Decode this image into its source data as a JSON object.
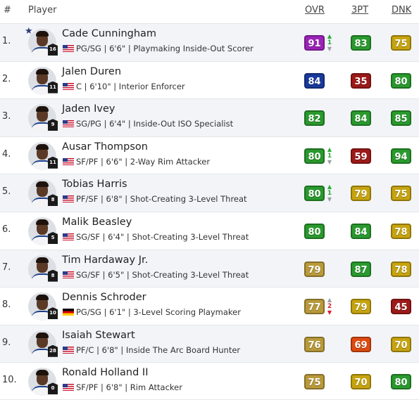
{
  "headers": {
    "rank": "#",
    "player": "Player",
    "ovr": "OVR",
    "three": "3PT",
    "dnk": "DNK"
  },
  "colors": {
    "elite_purple": "#9b24b8",
    "blue": "#1a3a9c",
    "green": "#2a9a2e",
    "olive": "#b99a3b",
    "gold": "#c7a40f",
    "red": "#9e1a1a",
    "orange": "#e04a0f"
  },
  "rows": [
    {
      "rank": "1.",
      "name": "Cade Cunningham",
      "country": "us",
      "info": "PG/SG | 6'6\" | Playmaking Inside-Out Scorer",
      "jersey": "16",
      "star": true,
      "ovr": {
        "value": "91",
        "color": "#9b24b8"
      },
      "trend": {
        "dir": "up",
        "value": "1"
      },
      "three": {
        "value": "83",
        "color": "#2a9a2e"
      },
      "dnk": {
        "value": "75",
        "color": "#c7a40f"
      }
    },
    {
      "rank": "2.",
      "name": "Jalen Duren",
      "country": "us",
      "info": "C | 6'10\" | Interior Enforcer",
      "jersey": "11",
      "star": false,
      "ovr": {
        "value": "84",
        "color": "#1a3a9c"
      },
      "trend": null,
      "three": {
        "value": "35",
        "color": "#9e1a1a"
      },
      "dnk": {
        "value": "80",
        "color": "#2a9a2e"
      }
    },
    {
      "rank": "3.",
      "name": "Jaden Ivey",
      "country": "us",
      "info": "SG/PG | 6'4\" | Inside-Out ISO Specialist",
      "jersey": "9",
      "star": false,
      "ovr": {
        "value": "82",
        "color": "#2a9a2e"
      },
      "trend": null,
      "three": {
        "value": "84",
        "color": "#2a9a2e"
      },
      "dnk": {
        "value": "85",
        "color": "#2a9a2e"
      }
    },
    {
      "rank": "4.",
      "name": "Ausar Thompson",
      "country": "us",
      "info": "SF/PF | 6'6\" | 2-Way Rim Attacker",
      "jersey": "11",
      "star": false,
      "ovr": {
        "value": "80",
        "color": "#2a9a2e"
      },
      "trend": {
        "dir": "up",
        "value": "1"
      },
      "three": {
        "value": "59",
        "color": "#9e1a1a"
      },
      "dnk": {
        "value": "94",
        "color": "#2a9a2e"
      }
    },
    {
      "rank": "5.",
      "name": "Tobias Harris",
      "country": "us",
      "info": "PF/SF | 6'8\" | Shot-Creating 3-Level Threat",
      "jersey": "8",
      "star": false,
      "ovr": {
        "value": "80",
        "color": "#2a9a2e"
      },
      "trend": {
        "dir": "up",
        "value": "1"
      },
      "three": {
        "value": "79",
        "color": "#c7a40f"
      },
      "dnk": {
        "value": "75",
        "color": "#c7a40f"
      }
    },
    {
      "rank": "6.",
      "name": "Malik Beasley",
      "country": "us",
      "info": "SG/SF | 6'4\" | Shot-Creating 3-Level Threat",
      "jersey": "5",
      "star": false,
      "ovr": {
        "value": "80",
        "color": "#2a9a2e"
      },
      "trend": null,
      "three": {
        "value": "84",
        "color": "#2a9a2e"
      },
      "dnk": {
        "value": "78",
        "color": "#c7a40f"
      }
    },
    {
      "rank": "7.",
      "name": "Tim Hardaway Jr.",
      "country": "us",
      "info": "SG/SF | 6'5\" | Shot-Creating 3-Level Threat",
      "jersey": "8",
      "star": false,
      "ovr": {
        "value": "79",
        "color": "#b99a3b"
      },
      "trend": null,
      "three": {
        "value": "87",
        "color": "#2a9a2e"
      },
      "dnk": {
        "value": "78",
        "color": "#c7a40f"
      }
    },
    {
      "rank": "8.",
      "name": "Dennis Schroder",
      "country": "de",
      "info": "PG/SG | 6'1\" | 3-Level Scoring Playmaker",
      "jersey": "10",
      "star": false,
      "ovr": {
        "value": "77",
        "color": "#b99a3b"
      },
      "trend": {
        "dir": "down",
        "value": "2"
      },
      "three": {
        "value": "79",
        "color": "#c7a40f"
      },
      "dnk": {
        "value": "45",
        "color": "#9e1a1a"
      }
    },
    {
      "rank": "9.",
      "name": "Isaiah Stewart",
      "country": "us",
      "info": "PF/C | 6'8\" | Inside The Arc Board Hunter",
      "jersey": "28",
      "star": false,
      "ovr": {
        "value": "76",
        "color": "#b99a3b"
      },
      "trend": null,
      "three": {
        "value": "69",
        "color": "#e04a0f"
      },
      "dnk": {
        "value": "70",
        "color": "#c7a40f"
      }
    },
    {
      "rank": "10.",
      "name": "Ronald Holland II",
      "country": "us",
      "info": "SF/PF | 6'8\" | Rim Attacker",
      "jersey": "0",
      "star": false,
      "ovr": {
        "value": "75",
        "color": "#b99a3b"
      },
      "trend": null,
      "three": {
        "value": "70",
        "color": "#c7a40f"
      },
      "dnk": {
        "value": "80",
        "color": "#2a9a2e"
      }
    }
  ]
}
